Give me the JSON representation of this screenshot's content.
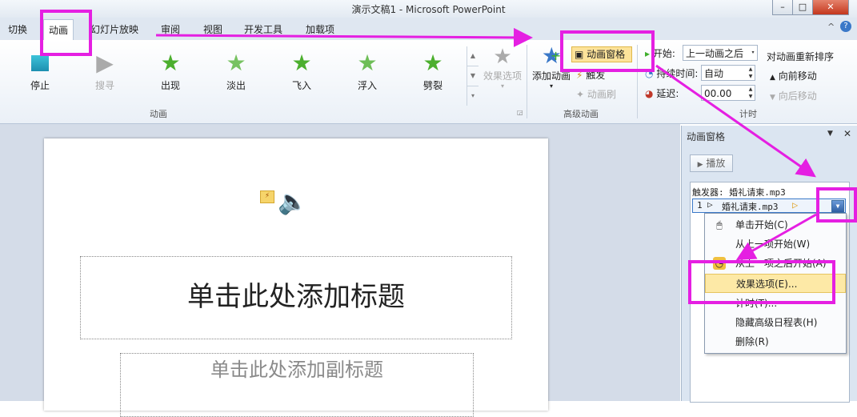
{
  "window": {
    "title": "演示文稿1 - Microsoft PowerPoint",
    "minimize_glyph": "–",
    "maximize_glyph": "□",
    "close_glyph": "✕"
  },
  "tabs": [
    {
      "label": "切换"
    },
    {
      "label": "动画"
    },
    {
      "label": "幻灯片放映"
    },
    {
      "label": "审阅"
    },
    {
      "label": "视图"
    },
    {
      "label": "开发工具"
    },
    {
      "label": "加载项"
    }
  ],
  "help": {
    "chevron": "^",
    "icon": "?"
  },
  "ribbon": {
    "animations": [
      {
        "label": "停止",
        "icon": "stop-icon"
      },
      {
        "label": "搜寻",
        "icon": "seek-icon"
      },
      {
        "label": "出现",
        "icon": "appear-star-icon"
      },
      {
        "label": "淡出",
        "icon": "fade-star-icon"
      },
      {
        "label": "飞入",
        "icon": "fly-in-star-icon"
      },
      {
        "label": "浮入",
        "icon": "float-in-star-icon"
      },
      {
        "label": "劈裂",
        "icon": "split-star-icon"
      }
    ],
    "effect_options": "效果选项",
    "group_animation": "动画",
    "add_animation": "添加动画",
    "animation_pane": "动画窗格",
    "trigger": "触发",
    "animation_painter": "动画刷",
    "group_advanced": "高级动画",
    "start_label": "开始:",
    "start_value": "上一动画之后",
    "duration_label": "持续时间:",
    "duration_value": "自动",
    "delay_label": "延迟:",
    "delay_value": "00.00",
    "group_timing_partial": "计时",
    "reorder_title": "对动画重新排序",
    "move_earlier": "向前移动",
    "move_later": "向后移动"
  },
  "slide": {
    "title_placeholder": "单击此处添加标题",
    "subtitle_placeholder": "单击此处添加副标题"
  },
  "pane": {
    "title": "动画窗格",
    "play": "播放",
    "trigger_row": "触发器: 婚礼请柬.mp3",
    "item_number": "1",
    "item_name": "婚礼请柬.mp3"
  },
  "context_menu": [
    {
      "label": "单击开始(C)",
      "icon": "mouse-icon"
    },
    {
      "label": "从上一项开始(W)",
      "icon": ""
    },
    {
      "label": "从上一项之后开始(A)",
      "icon": "clock-icon"
    },
    {
      "label": "效果选项(E)...",
      "icon": "",
      "selected": true
    },
    {
      "label": "计时(T)...",
      "icon": ""
    },
    {
      "label": "隐藏高级日程表(H)",
      "icon": ""
    },
    {
      "label": "删除(R)",
      "icon": ""
    }
  ],
  "colors": {
    "annotation": "#e51fe2",
    "ribbon_bg": "#eaf0f7",
    "workspace_bg": "#d4dce8",
    "pane_bg": "#dbe5f1",
    "selected_item": "#fde9a6",
    "star_green": "#4caf2e"
  }
}
